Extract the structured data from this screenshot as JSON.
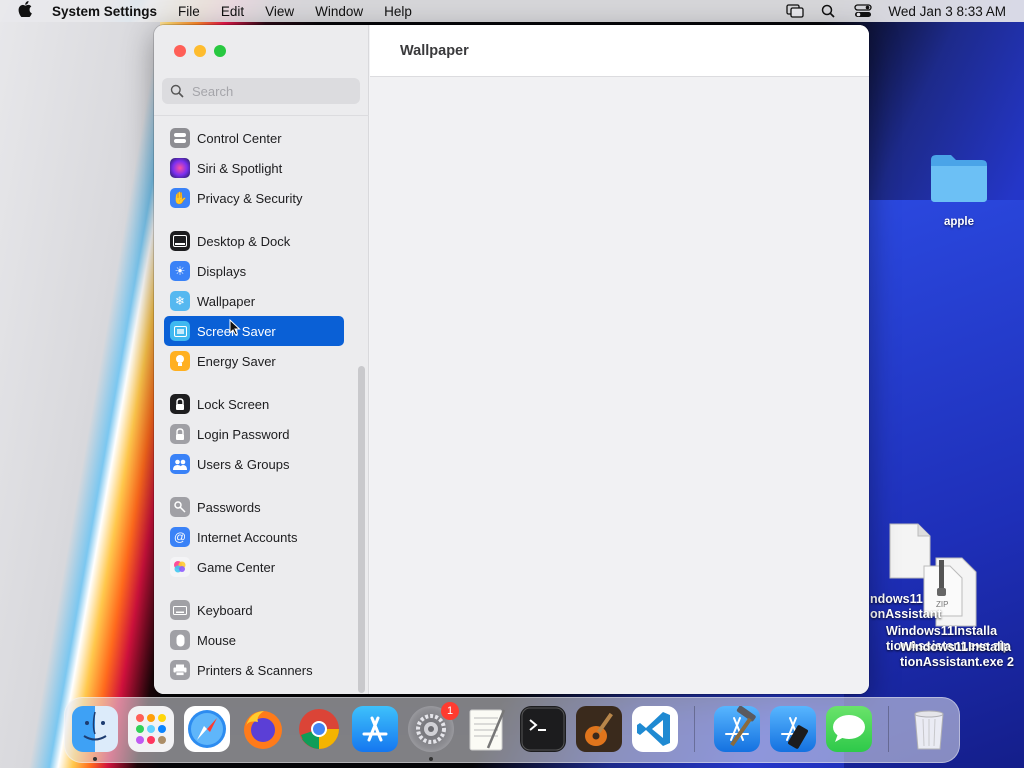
{
  "menubar": {
    "app_name": "System Settings",
    "menus": [
      "File",
      "Edit",
      "View",
      "Window",
      "Help"
    ],
    "clock": "Wed Jan 3  8:33 AM"
  },
  "window": {
    "search_placeholder": "Search",
    "title": "Wallpaper",
    "sidebar": {
      "items": [
        {
          "label": "Control Center",
          "icon": "control-center-icon",
          "color": "#8e8e93"
        },
        {
          "label": "Siri & Spotlight",
          "icon": "siri-icon",
          "color": "#b040d0"
        },
        {
          "label": "Privacy & Security",
          "icon": "hand-icon",
          "color": "#3a82f7"
        },
        {
          "label": "Desktop & Dock",
          "icon": "dock-icon",
          "color": "#1d1d1f"
        },
        {
          "label": "Displays",
          "icon": "sun-icon",
          "color": "#3a82f7"
        },
        {
          "label": "Wallpaper",
          "icon": "snowflake-icon",
          "color": "#55b8f0"
        },
        {
          "label": "Screen Saver",
          "icon": "screen-saver-icon",
          "color": "#3fb8f0"
        },
        {
          "label": "Energy Saver",
          "icon": "bulb-icon",
          "color": "#ffb020"
        },
        {
          "label": "Lock Screen",
          "icon": "lock-icon",
          "color": "#1d1d1f"
        },
        {
          "label": "Login Password",
          "icon": "password-lock-icon",
          "color": "#a0a0a5"
        },
        {
          "label": "Users & Groups",
          "icon": "users-icon",
          "color": "#3a82f7"
        },
        {
          "label": "Passwords",
          "icon": "key-icon",
          "color": "#a0a0a5"
        },
        {
          "label": "Internet Accounts",
          "icon": "at-icon",
          "color": "#3a82f7"
        },
        {
          "label": "Game Center",
          "icon": "game-center-icon",
          "color": "#f0f0f0"
        },
        {
          "label": "Keyboard",
          "icon": "keyboard-icon",
          "color": "#a0a0a5"
        },
        {
          "label": "Mouse",
          "icon": "mouse-icon",
          "color": "#a0a0a5"
        },
        {
          "label": "Printers & Scanners",
          "icon": "printer-icon",
          "color": "#a0a0a5"
        }
      ],
      "selected": "Screen Saver"
    }
  },
  "desktop": {
    "folder_label": "apple",
    "file1_label_line1": "ndows11",
    "file1_label_line2": "onAssistant",
    "file2_label_line1": "Windows11Installa",
    "file2_label_line2": "tionAssistant.exe.zip",
    "file3_label_line1": "Windows11Installa",
    "file3_label_line2": "tionAssistant.exe 2",
    "zip_tag": "ZIP"
  },
  "dock": {
    "apps": [
      "Finder",
      "Launchpad",
      "Safari",
      "Firefox",
      "Chrome",
      "App Store",
      "System Settings",
      "TextEdit",
      "Terminal",
      "GarageBand",
      "Visual Studio Code",
      "Xcode",
      "Simulator",
      "Messages",
      "Trash"
    ],
    "system_settings_badge": "1"
  }
}
